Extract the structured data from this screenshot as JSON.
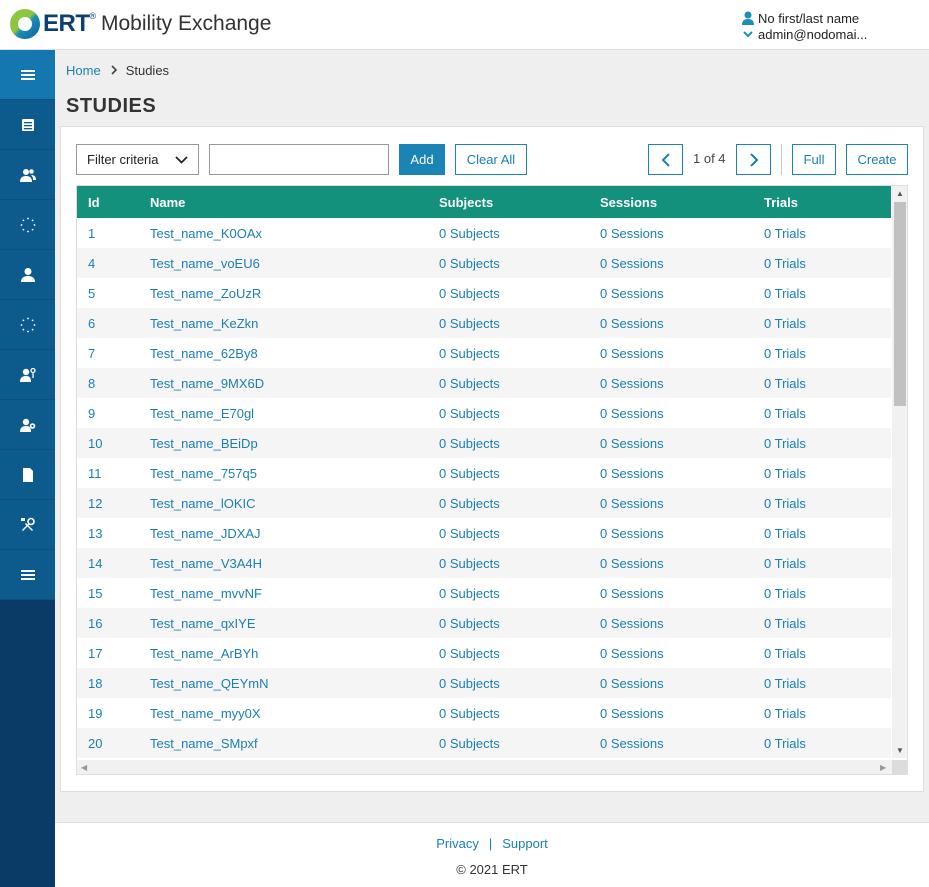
{
  "header": {
    "logo_text": "ERT",
    "logo_tm": "®",
    "app_title": "Mobility Exchange",
    "user_name": "No first/last name",
    "user_email": "admin@nodomai..."
  },
  "sidebar": {
    "items": [
      {
        "icon": "menu-icon"
      },
      {
        "icon": "list-icon"
      },
      {
        "icon": "users-icon"
      },
      {
        "icon": "loading-icon"
      },
      {
        "icon": "user-icon"
      },
      {
        "icon": "loading-icon"
      },
      {
        "icon": "user-key-icon"
      },
      {
        "icon": "user-settings-icon"
      },
      {
        "icon": "document-icon"
      },
      {
        "icon": "tools-icon"
      },
      {
        "icon": "hamburger-icon"
      }
    ]
  },
  "breadcrumb": {
    "home": "Home",
    "current": "Studies"
  },
  "page_title": "STUDIES",
  "toolbar": {
    "filter_label": "Filter criteria",
    "filter_value": "",
    "add_label": "Add",
    "clear_label": "Clear All",
    "page_info": "1 of 4",
    "full_label": "Full",
    "create_label": "Create"
  },
  "table": {
    "columns": [
      "Id",
      "Name",
      "Subjects",
      "Sessions",
      "Trials"
    ],
    "rows": [
      {
        "id": "1",
        "name": "Test_name_K0OAx",
        "subjects": "0 Subjects",
        "sessions": "0 Sessions",
        "trials": "0 Trials"
      },
      {
        "id": "4",
        "name": "Test_name_voEU6",
        "subjects": "0 Subjects",
        "sessions": "0 Sessions",
        "trials": "0 Trials"
      },
      {
        "id": "5",
        "name": "Test_name_ZoUzR",
        "subjects": "0 Subjects",
        "sessions": "0 Sessions",
        "trials": "0 Trials"
      },
      {
        "id": "6",
        "name": "Test_name_KeZkn",
        "subjects": "0 Subjects",
        "sessions": "0 Sessions",
        "trials": "0 Trials"
      },
      {
        "id": "7",
        "name": "Test_name_62By8",
        "subjects": "0 Subjects",
        "sessions": "0 Sessions",
        "trials": "0 Trials"
      },
      {
        "id": "8",
        "name": "Test_name_9MX6D",
        "subjects": "0 Subjects",
        "sessions": "0 Sessions",
        "trials": "0 Trials"
      },
      {
        "id": "9",
        "name": "Test_name_E70gl",
        "subjects": "0 Subjects",
        "sessions": "0 Sessions",
        "trials": "0 Trials"
      },
      {
        "id": "10",
        "name": "Test_name_BEiDp",
        "subjects": "0 Subjects",
        "sessions": "0 Sessions",
        "trials": "0 Trials"
      },
      {
        "id": "11",
        "name": "Test_name_757q5",
        "subjects": "0 Subjects",
        "sessions": "0 Sessions",
        "trials": "0 Trials"
      },
      {
        "id": "12",
        "name": "Test_name_lOKIC",
        "subjects": "0 Subjects",
        "sessions": "0 Sessions",
        "trials": "0 Trials"
      },
      {
        "id": "13",
        "name": "Test_name_JDXAJ",
        "subjects": "0 Subjects",
        "sessions": "0 Sessions",
        "trials": "0 Trials"
      },
      {
        "id": "14",
        "name": "Test_name_V3A4H",
        "subjects": "0 Subjects",
        "sessions": "0 Sessions",
        "trials": "0 Trials"
      },
      {
        "id": "15",
        "name": "Test_name_mvvNF",
        "subjects": "0 Subjects",
        "sessions": "0 Sessions",
        "trials": "0 Trials"
      },
      {
        "id": "16",
        "name": "Test_name_qxIYE",
        "subjects": "0 Subjects",
        "sessions": "0 Sessions",
        "trials": "0 Trials"
      },
      {
        "id": "17",
        "name": "Test_name_ArBYh",
        "subjects": "0 Subjects",
        "sessions": "0 Sessions",
        "trials": "0 Trials"
      },
      {
        "id": "18",
        "name": "Test_name_QEYmN",
        "subjects": "0 Subjects",
        "sessions": "0 Sessions",
        "trials": "0 Trials"
      },
      {
        "id": "19",
        "name": "Test_name_myy0X",
        "subjects": "0 Subjects",
        "sessions": "0 Sessions",
        "trials": "0 Trials"
      },
      {
        "id": "20",
        "name": "Test_name_SMpxf",
        "subjects": "0 Subjects",
        "sessions": "0 Sessions",
        "trials": "0 Trials"
      }
    ]
  },
  "footer": {
    "privacy": "Privacy",
    "separator": "|",
    "support": "Support",
    "copyright": "© 2021 ERT"
  },
  "colors": {
    "table_header": "#13917c",
    "link": "#1a7fb3",
    "sidebar": "#0d5a8c",
    "sidebar_active": "#1577b0",
    "add_button": "#1a85b5"
  }
}
